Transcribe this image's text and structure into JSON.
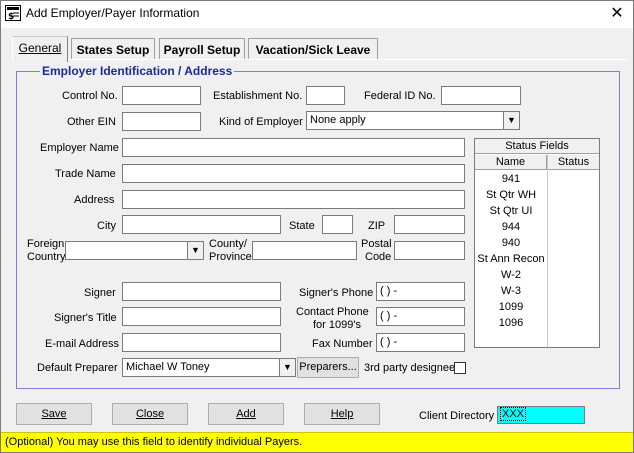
{
  "window": {
    "title": "Add Employer/Payer Information",
    "close_glyph": "✕"
  },
  "tabs": [
    {
      "label": "General",
      "active": true
    },
    {
      "label": "States Setup",
      "active": false
    },
    {
      "label": "Payroll Setup",
      "active": false
    },
    {
      "label": "Vacation/Sick Leave",
      "active": false
    }
  ],
  "group": {
    "title": "Employer Identification / Address"
  },
  "fields": {
    "control_no": {
      "label": "Control No.",
      "value": ""
    },
    "establishment_no": {
      "label": "Establishment No.",
      "value": ""
    },
    "federal_id": {
      "label": "Federal ID No.",
      "value": ""
    },
    "other_ein": {
      "label": "Other EIN",
      "value": ""
    },
    "kind_of_employer": {
      "label": "Kind of Employer",
      "value": "None apply"
    },
    "employer_name": {
      "label": "Employer Name",
      "value": ""
    },
    "trade_name": {
      "label": "Trade Name",
      "value": ""
    },
    "address": {
      "label": "Address",
      "value": ""
    },
    "city": {
      "label": "City",
      "value": ""
    },
    "state": {
      "label": "State",
      "value": ""
    },
    "zip": {
      "label": "ZIP",
      "value": ""
    },
    "foreign_country": {
      "label_line1": "Foreign",
      "label_line2": "Country",
      "value": ""
    },
    "county": {
      "label_line1": "County/",
      "label_line2": "Province",
      "value": ""
    },
    "postal_code": {
      "label_line1": "Postal",
      "label_line2": "Code",
      "value": ""
    },
    "signer": {
      "label": "Signer",
      "value": ""
    },
    "signers_phone": {
      "label": "Signer's Phone",
      "value": "(   )    -"
    },
    "signers_title": {
      "label": "Signer's Title",
      "value": ""
    },
    "contact_phone": {
      "label_line1": "Contact Phone",
      "label_line2": "for 1099's",
      "value": "(   )    -"
    },
    "email": {
      "label": "E-mail Address",
      "value": ""
    },
    "fax": {
      "label": "Fax Number",
      "value": "(   )    -"
    },
    "default_preparer": {
      "label": "Default Preparer",
      "value": "Michael W Toney"
    },
    "third_party": {
      "label": "3rd party designee",
      "checked": false
    }
  },
  "preparers_button": "Preparers...",
  "status_fields": {
    "title": "Status Fields",
    "col_name": "Name",
    "col_status": "Status",
    "rows": [
      "941",
      "St Qtr WH",
      "St Qtr UI",
      "944",
      "940",
      "St Ann Recon",
      "W-2",
      "W-3",
      "1099",
      "1096"
    ]
  },
  "buttons": {
    "save": "Save",
    "close": "Close",
    "add": "Add",
    "help": "Help"
  },
  "client_directory": {
    "label": "Client Directory",
    "value": "XXX",
    "color": "#00ffff"
  },
  "status_bar": {
    "text": "(Optional) You may use this field to identify individual Payers.",
    "color": "#ffff00"
  }
}
